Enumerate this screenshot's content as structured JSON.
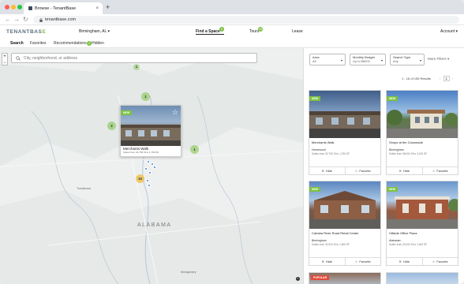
{
  "browser": {
    "tab_title": "Browse - TenantBase",
    "tab_close": "×",
    "new_tab": "+",
    "url": "tenantbase.com",
    "back": "←",
    "forward": "→",
    "reload": "↻"
  },
  "header": {
    "logo_main": "TENANTBAS",
    "logo_accent": "E",
    "location": "Birmingham, AL",
    "location_caret": "▾",
    "nav": [
      {
        "label": "Find a Space",
        "badge": "1"
      },
      {
        "label": "Tours",
        "badge": "26"
      },
      {
        "label": "Lease",
        "badge": ""
      }
    ],
    "account": "Account",
    "account_caret": "▾"
  },
  "subnav": {
    "items": [
      "Search",
      "Favorites",
      "Recommendations",
      "Hidden"
    ],
    "recommendations_badge": "2"
  },
  "map": {
    "zoom_in": "+",
    "zoom_out": "−",
    "search_placeholder": "City, neighborhood, or address",
    "clusters": [
      "1",
      "1",
      "2",
      "1",
      "10"
    ],
    "labels": [
      "Tuscaloosa",
      "ALABAMA",
      "Montgomery"
    ],
    "info": "i",
    "popup": {
      "badge": "NEW",
      "name": "Merchants Walk",
      "sub": "Suites from 32,750 Sf to 1,760 SF"
    }
  },
  "filters": [
    {
      "label": "Area",
      "value": "All"
    },
    {
      "label": "Monthly Budget",
      "value": "Up to $8000"
    },
    {
      "label": "Search Type",
      "value": "Any"
    }
  ],
  "more_filters": "More Filters",
  "more_filters_caret": "▾",
  "results_text": "1 - 16 of 155 Results",
  "pager": {
    "prev": "‹",
    "page": "1",
    "next": "›"
  },
  "cards": [
    {
      "badge": "NEW",
      "name": "Merchants Walk",
      "city": "Homewood",
      "sub": "Suites from 32,750 Sf to 1,760 SF",
      "hide": "Hide",
      "favorite": "Favorite"
    },
    {
      "badge": "NEW",
      "name": "Shops at the Colonnade",
      "city": "Birmingham",
      "sub": "Suites from 38,000 Sf to 3,105 SF",
      "hide": "Hide",
      "favorite": "Favorite"
    },
    {
      "badge": "NEW",
      "name": "Cahaba River Road Retail Center",
      "city": "Birmingham",
      "sub": "Suites from 32,000 Sf to 1,600 SF",
      "hide": "Hide",
      "favorite": "Favorite"
    },
    {
      "badge": "NEW",
      "name": "Hillside Office Plaza",
      "city": "Alabaster",
      "sub": "Suites from 25,000 Sf to 1,400 SF",
      "hide": "Hide",
      "favorite": "Favorite"
    }
  ],
  "popular_badge": "POPULAR"
}
